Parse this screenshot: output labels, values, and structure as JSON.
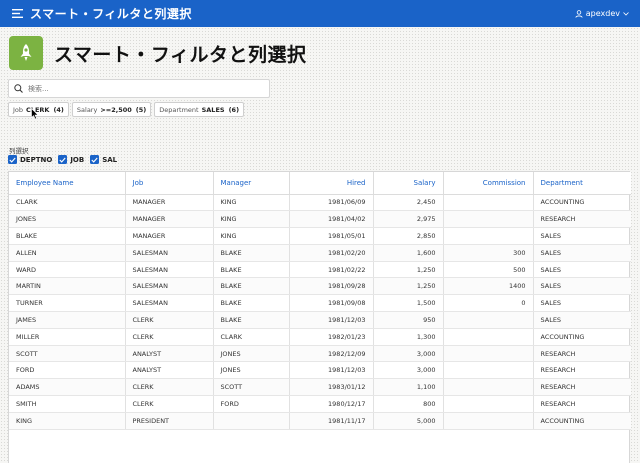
{
  "header": {
    "app_title": "スマート・フィルタと列選択",
    "username": "apexdev",
    "colors": {
      "bar": "#1a63c8",
      "hero_icon": "#7cb342"
    }
  },
  "hero": {
    "title": "スマート・フィルタと列選択",
    "icon": "rocket-icon"
  },
  "search": {
    "placeholder": "検索..."
  },
  "filter_chips": [
    {
      "label": "Job",
      "value": "CLERK",
      "count": "(4)"
    },
    {
      "label": "Salary",
      "value": ">=2,500",
      "count": "(5)"
    },
    {
      "label": "Department",
      "value": "SALES",
      "count": "(6)"
    }
  ],
  "column_select": {
    "label": "列選択",
    "options": [
      {
        "label": "DEPTNO",
        "checked": true
      },
      {
        "label": "JOB",
        "checked": true
      },
      {
        "label": "SAL",
        "checked": true
      }
    ]
  },
  "table": {
    "columns": [
      "Employee Name",
      "Job",
      "Manager",
      "Hired",
      "Salary",
      "Commission",
      "Department"
    ],
    "rows": [
      [
        "CLARK",
        "MANAGER",
        "KING",
        "1981/06/09",
        "2,450",
        "",
        "ACCOUNTING"
      ],
      [
        "JONES",
        "MANAGER",
        "KING",
        "1981/04/02",
        "2,975",
        "",
        "RESEARCH"
      ],
      [
        "BLAKE",
        "MANAGER",
        "KING",
        "1981/05/01",
        "2,850",
        "",
        "SALES"
      ],
      [
        "ALLEN",
        "SALESMAN",
        "BLAKE",
        "1981/02/20",
        "1,600",
        "300",
        "SALES"
      ],
      [
        "WARD",
        "SALESMAN",
        "BLAKE",
        "1981/02/22",
        "1,250",
        "500",
        "SALES"
      ],
      [
        "MARTIN",
        "SALESMAN",
        "BLAKE",
        "1981/09/28",
        "1,250",
        "1400",
        "SALES"
      ],
      [
        "TURNER",
        "SALESMAN",
        "BLAKE",
        "1981/09/08",
        "1,500",
        "0",
        "SALES"
      ],
      [
        "JAMES",
        "CLERK",
        "BLAKE",
        "1981/12/03",
        "950",
        "",
        "SALES"
      ],
      [
        "MILLER",
        "CLERK",
        "CLARK",
        "1982/01/23",
        "1,300",
        "",
        "ACCOUNTING"
      ],
      [
        "SCOTT",
        "ANALYST",
        "JONES",
        "1982/12/09",
        "3,000",
        "",
        "RESEARCH"
      ],
      [
        "FORD",
        "ANALYST",
        "JONES",
        "1981/12/03",
        "3,000",
        "",
        "RESEARCH"
      ],
      [
        "ADAMS",
        "CLERK",
        "SCOTT",
        "1983/01/12",
        "1,100",
        "",
        "RESEARCH"
      ],
      [
        "SMITH",
        "CLERK",
        "FORD",
        "1980/12/17",
        "800",
        "",
        "RESEARCH"
      ],
      [
        "KING",
        "PRESIDENT",
        "",
        "1981/11/17",
        "5,000",
        "",
        "ACCOUNTING"
      ]
    ]
  }
}
